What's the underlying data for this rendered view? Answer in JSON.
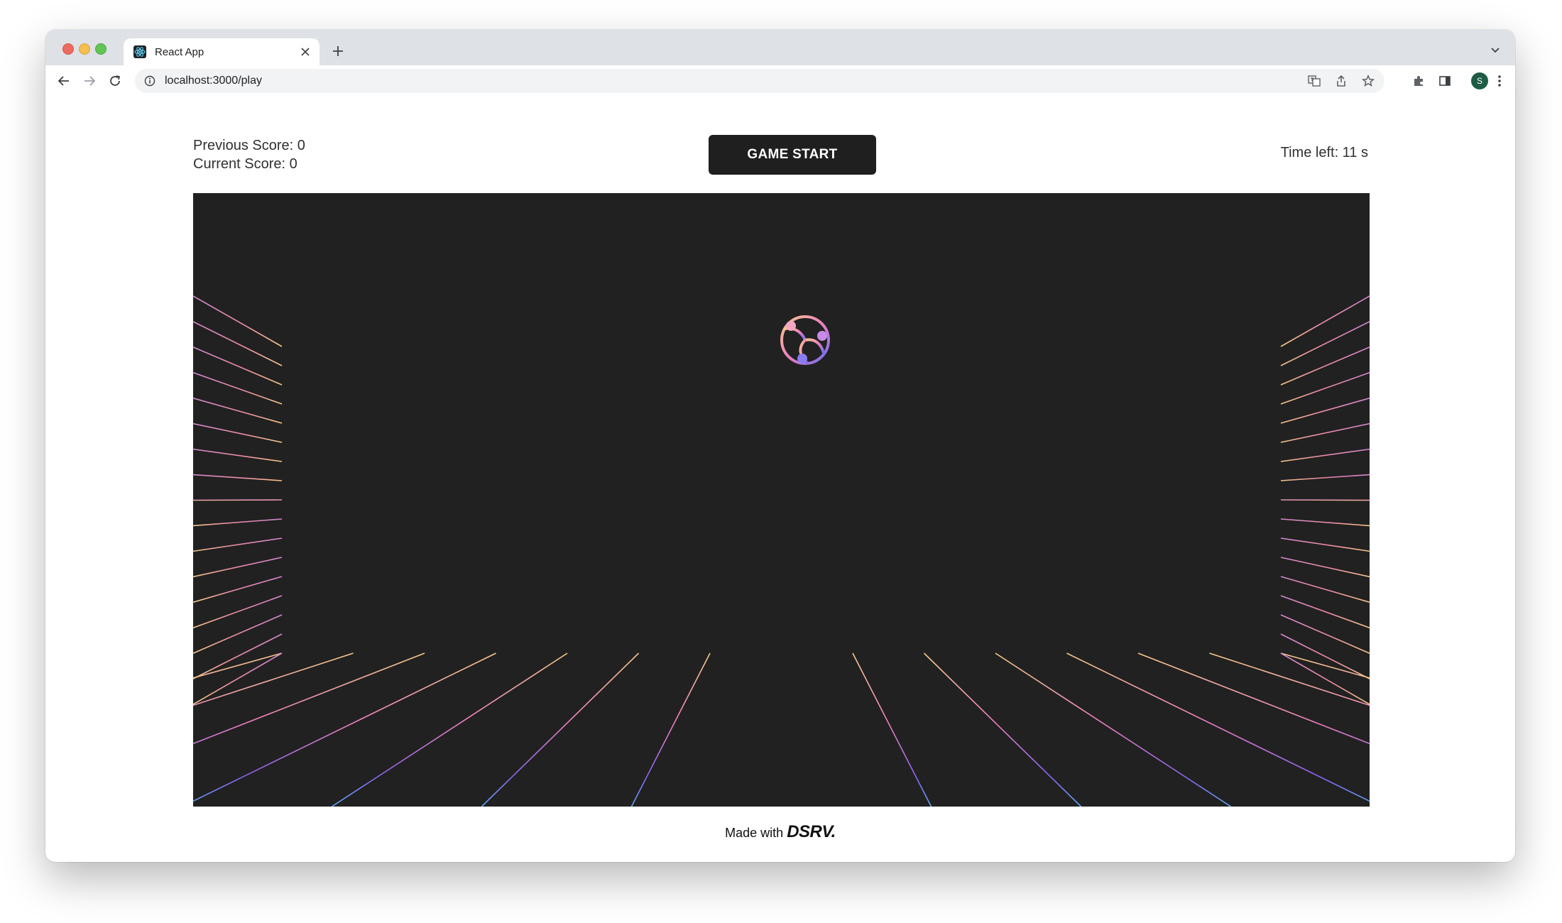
{
  "browser": {
    "tab_title": "React App",
    "url": "localhost:3000/play",
    "avatar_letter": "S",
    "icons": [
      "react-logo-icon",
      "close-icon",
      "plus-icon",
      "chevron-down-icon",
      "back-icon",
      "forward-icon",
      "reload-icon",
      "info-icon",
      "translate-icon",
      "share-icon",
      "star-icon",
      "puzzle-icon",
      "sidepanel-icon",
      "kebab-menu-icon"
    ]
  },
  "game": {
    "previous_score": "Previous Score: 0",
    "current_score": "Current Score: 0",
    "start_label": "GAME START",
    "time_left": "Time left: 11 s",
    "ball_icon": "ball-icon",
    "grid_colors": {
      "warm": "#f7c98a",
      "pink": "#ee7fc0",
      "violet": "#8a63f0",
      "blue": "#5fa8f5"
    },
    "canvas_background": "#212121"
  },
  "footer": {
    "prefix": "Made with",
    "brand": "DSRV."
  }
}
